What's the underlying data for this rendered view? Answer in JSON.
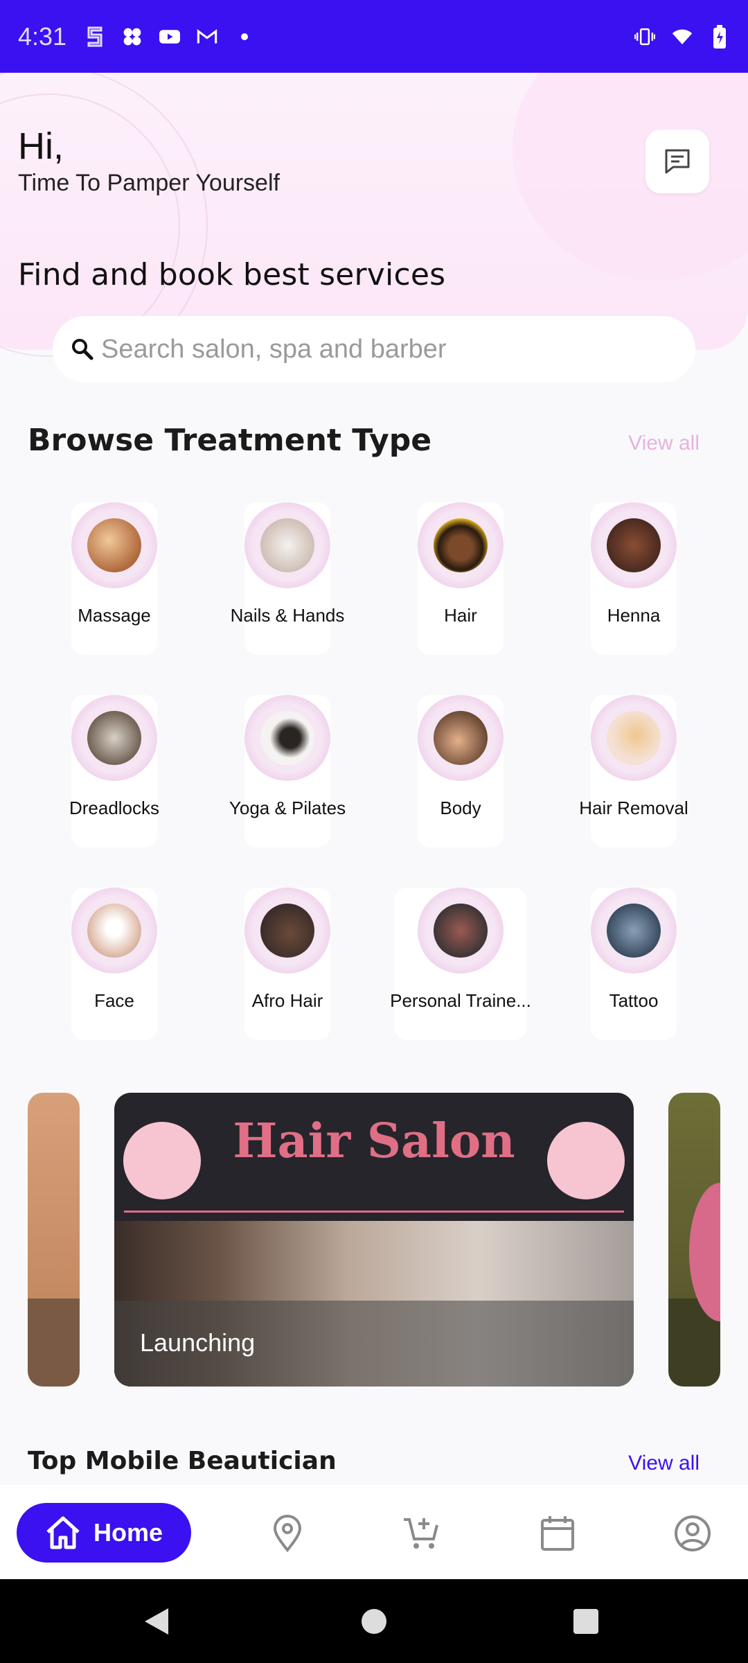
{
  "status_bar": {
    "time": "4:31"
  },
  "header": {
    "greeting": "Hi,",
    "subtitle": "Time To Pamper Yourself",
    "find_title": "Find and book best services"
  },
  "search": {
    "placeholder": "Search salon, spa and barber"
  },
  "browse": {
    "title": "Browse Treatment Type",
    "view_all": "View all",
    "categories": [
      {
        "label": "Massage"
      },
      {
        "label": "Nails & Hands"
      },
      {
        "label": "Hair"
      },
      {
        "label": "Henna"
      },
      {
        "label": "Dreadlocks"
      },
      {
        "label": "Yoga & Pilates"
      },
      {
        "label": "Body"
      },
      {
        "label": "Hair Removal"
      },
      {
        "label": "Face"
      },
      {
        "label": "Afro Hair"
      },
      {
        "label": "Personal Traine..."
      },
      {
        "label": "Tattoo"
      }
    ]
  },
  "banner": {
    "title": "Hair Salon",
    "label": "Launching"
  },
  "beautician": {
    "title": "Top Mobile Beautician",
    "view_all": "View all"
  },
  "nav": {
    "home": "Home"
  },
  "colors": {
    "brand": "#3b10f1",
    "accent_pink": "#e06f86",
    "view_all_faded": "#e4b3e0"
  }
}
